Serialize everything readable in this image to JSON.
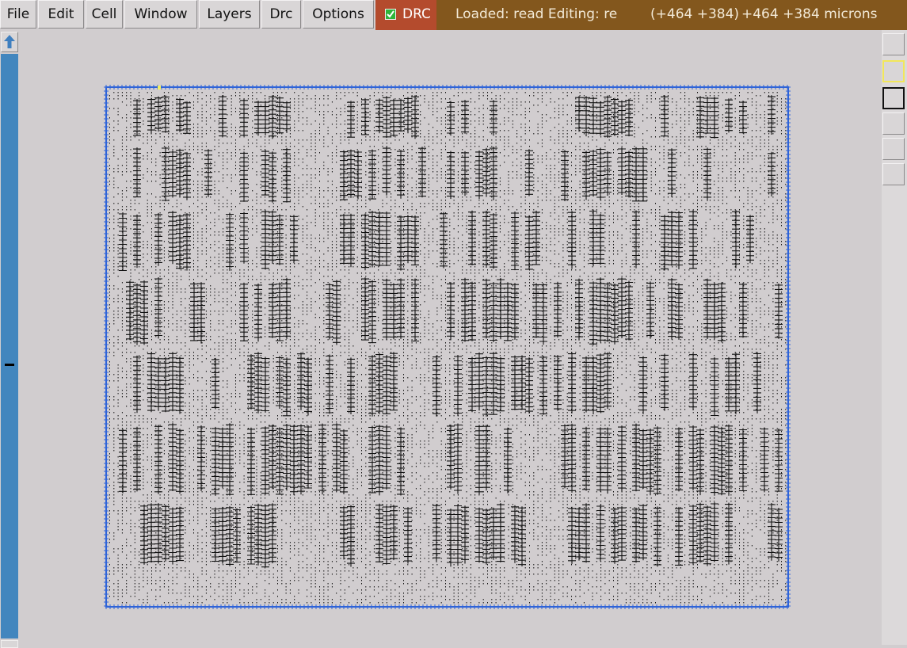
{
  "menubar": {
    "items": [
      "File",
      "Edit",
      "Cell",
      "Window",
      "Layers",
      "Drc",
      "Options"
    ]
  },
  "drc": {
    "label": "DRC",
    "checked": true
  },
  "status": {
    "message": "Loaded: read Editing: re",
    "coords": "(+464 +384)",
    "units": "+464 +384 microns"
  },
  "colors": {
    "background": "#d1cdcf",
    "drc_bg": "#b44b2d",
    "status_bg": "#83571d",
    "scrollbar": "#4286be",
    "boundary": "#2e63d8",
    "geometry": "#111111",
    "marker": "#f2f060"
  },
  "icons": {
    "scroll_up": "up-arrow-icon",
    "scroll_down": "down-arrow-icon",
    "drc_check": "checkmark-icon"
  },
  "layer_slots": [
    "empty",
    "yellow-outline",
    "black-outline",
    "empty",
    "empty",
    "empty"
  ]
}
